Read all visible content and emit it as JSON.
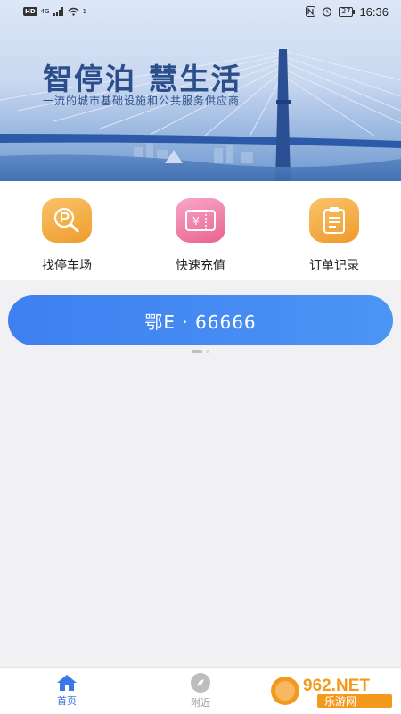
{
  "status_bar": {
    "hd": "HD",
    "network": "4G",
    "wifi_sub": "1",
    "battery": "27",
    "time": "16:36"
  },
  "banner": {
    "title": "智停泊 慧生活",
    "subtitle": "一流的城市基础设施和公共服务供应商"
  },
  "actions": [
    {
      "label": "找停车场",
      "icon": "parking-search-icon"
    },
    {
      "label": "快速充值",
      "icon": "recharge-ticket-icon"
    },
    {
      "label": "订单记录",
      "icon": "order-clipboard-icon"
    }
  ],
  "plate": {
    "label": "鄂E · 66666"
  },
  "bottom_nav": [
    {
      "label": "首页",
      "icon": "home-icon",
      "active": true
    },
    {
      "label": "附近",
      "icon": "compass-icon",
      "active": false
    }
  ],
  "watermark": {
    "brand": "962.NET",
    "sub": "乐游网"
  },
  "colors": {
    "accent": "#3a78ea",
    "plate_gradient_start": "#3f7ff0",
    "plate_gradient_end": "#4a95f5",
    "banner_text": "#2c4f8c"
  }
}
